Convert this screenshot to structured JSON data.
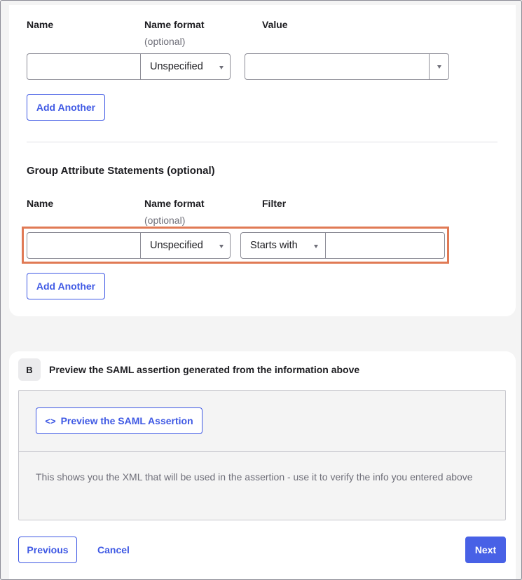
{
  "attribute_statements": {
    "col_name": "Name",
    "col_name_format": "Name format",
    "col_optional": "(optional)",
    "col_value": "Value",
    "name_format_value": "Unspecified",
    "add_another_label": "Add Another"
  },
  "group_statements": {
    "title": "Group Attribute Statements (optional)",
    "col_name": "Name",
    "col_name_format": "Name format",
    "col_optional": "(optional)",
    "col_filter": "Filter",
    "name_format_value": "Unspecified",
    "filter_type_value": "Starts with",
    "add_another_label": "Add Another"
  },
  "preview": {
    "step": "B",
    "heading": "Preview the SAML assertion generated from the information above",
    "button_label": "Preview the SAML Assertion",
    "help": "This shows you the XML that will be used in the assertion - use it to verify the info you entered above"
  },
  "footer": {
    "previous_label": "Previous",
    "cancel_label": "Cancel",
    "next_label": "Next"
  },
  "colors": {
    "accent": "#3f59e4",
    "primary_button": "#4861e6",
    "highlight": "#e07a55"
  }
}
